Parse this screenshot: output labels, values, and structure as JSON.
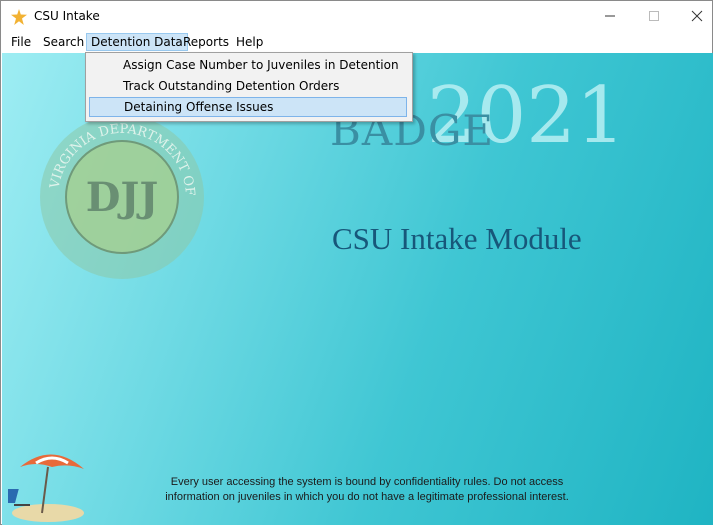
{
  "window": {
    "title": "CSU Intake",
    "icon": "star-app-icon"
  },
  "menubar": {
    "items": [
      "File",
      "Search",
      "Detention Data",
      "Reports",
      "Help"
    ],
    "active": "Detention Data"
  },
  "dropdown": {
    "items": [
      "Assign Case Number to Juveniles in Detention",
      "Track Outstanding Detention Orders",
      "Detaining Offense Issues"
    ],
    "hovered": "Detaining Offense Issues"
  },
  "content": {
    "brand": "BADGE",
    "year": "2021",
    "module_title": "CSU Intake Module",
    "footer_line1": "Every user accessing the system is bound by confidentiality rules. Do not access",
    "footer_line2": "information on juveniles in which you do not have a legitimate professional interest.",
    "seal_texts": [
      "VIRGINIA DEPARTMENT OF JUVENILE JUSTICE",
      "DJJ"
    ]
  },
  "colors": {
    "bg_start": "#9eedf3",
    "bg_end": "#1fb4c3",
    "title": "#17577a",
    "menu_highlight": "#cce4f7"
  }
}
